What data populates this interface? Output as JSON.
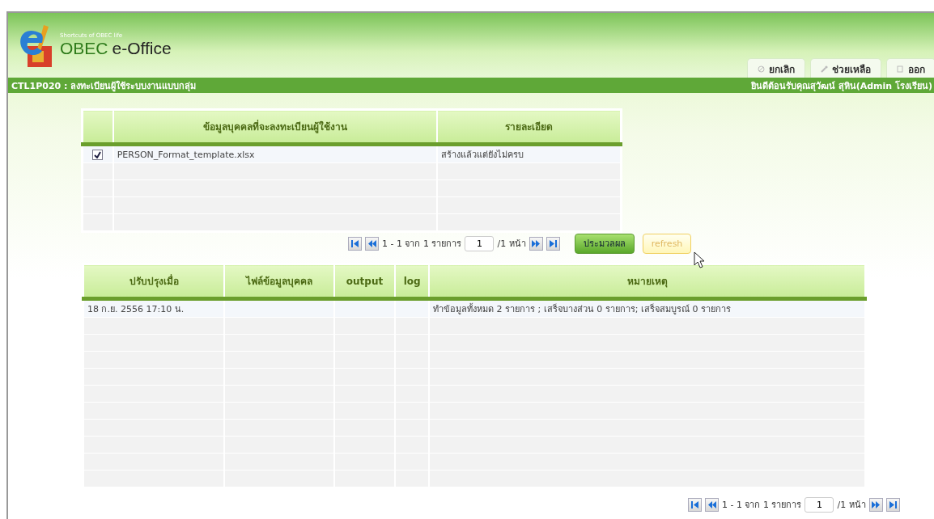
{
  "header": {
    "tagline": "Shortcuts of OBEC life",
    "title_parts": [
      "OBEC",
      "e-Office"
    ],
    "actions": [
      {
        "label": "ยกเลิก"
      },
      {
        "label": "ช่วยเหลือ"
      },
      {
        "label": "ออก"
      }
    ]
  },
  "title_bar": {
    "code": "CTL1P020 : ลงทะเบียนผู้ใช้ระบบงานแบบกลุ่ม",
    "welcome": "ยินดีต้อนรับคุณสุวัฒน์ สุหิน(Admin โรงเรียน)"
  },
  "upload_table": {
    "columns": [
      "ข้อมูลบุคคลที่จะลงทะเบียนผู้ใช้งาน",
      "รายละเอียด"
    ],
    "rows": [
      {
        "checked": true,
        "file": "PERSON_Format_template.xlsx",
        "detail": "สร้างแล้วแต่ยังไม่ครบ"
      }
    ]
  },
  "upload_pager": {
    "summary": "1 - 1 จาก 1 รายการ",
    "page": "1",
    "total": "/1 หน้า"
  },
  "buttons": [
    {
      "label": "ประมวลผล",
      "kind": "primary"
    },
    {
      "label": "refresh",
      "kind": "hover"
    }
  ],
  "log_table": {
    "columns": [
      "ปรับปรุงเมื่อ",
      "ไฟล์ข้อมูลบุคคล",
      "output",
      "log",
      "หมายเหตุ"
    ],
    "rows": [
      [
        "18 ก.ย. 2556 17:10 น.",
        "",
        "",
        "",
        "ทำข้อมูลทั้งหมด 2 รายการ ; เสร็จบางส่วน 0 รายการ; เสร็จสมบูรณ์ 0 รายการ"
      ]
    ]
  },
  "log_pager": {
    "summary": "1 - 1 จาก 1 รายการ",
    "page": "1",
    "total": "/1 หน้า"
  }
}
